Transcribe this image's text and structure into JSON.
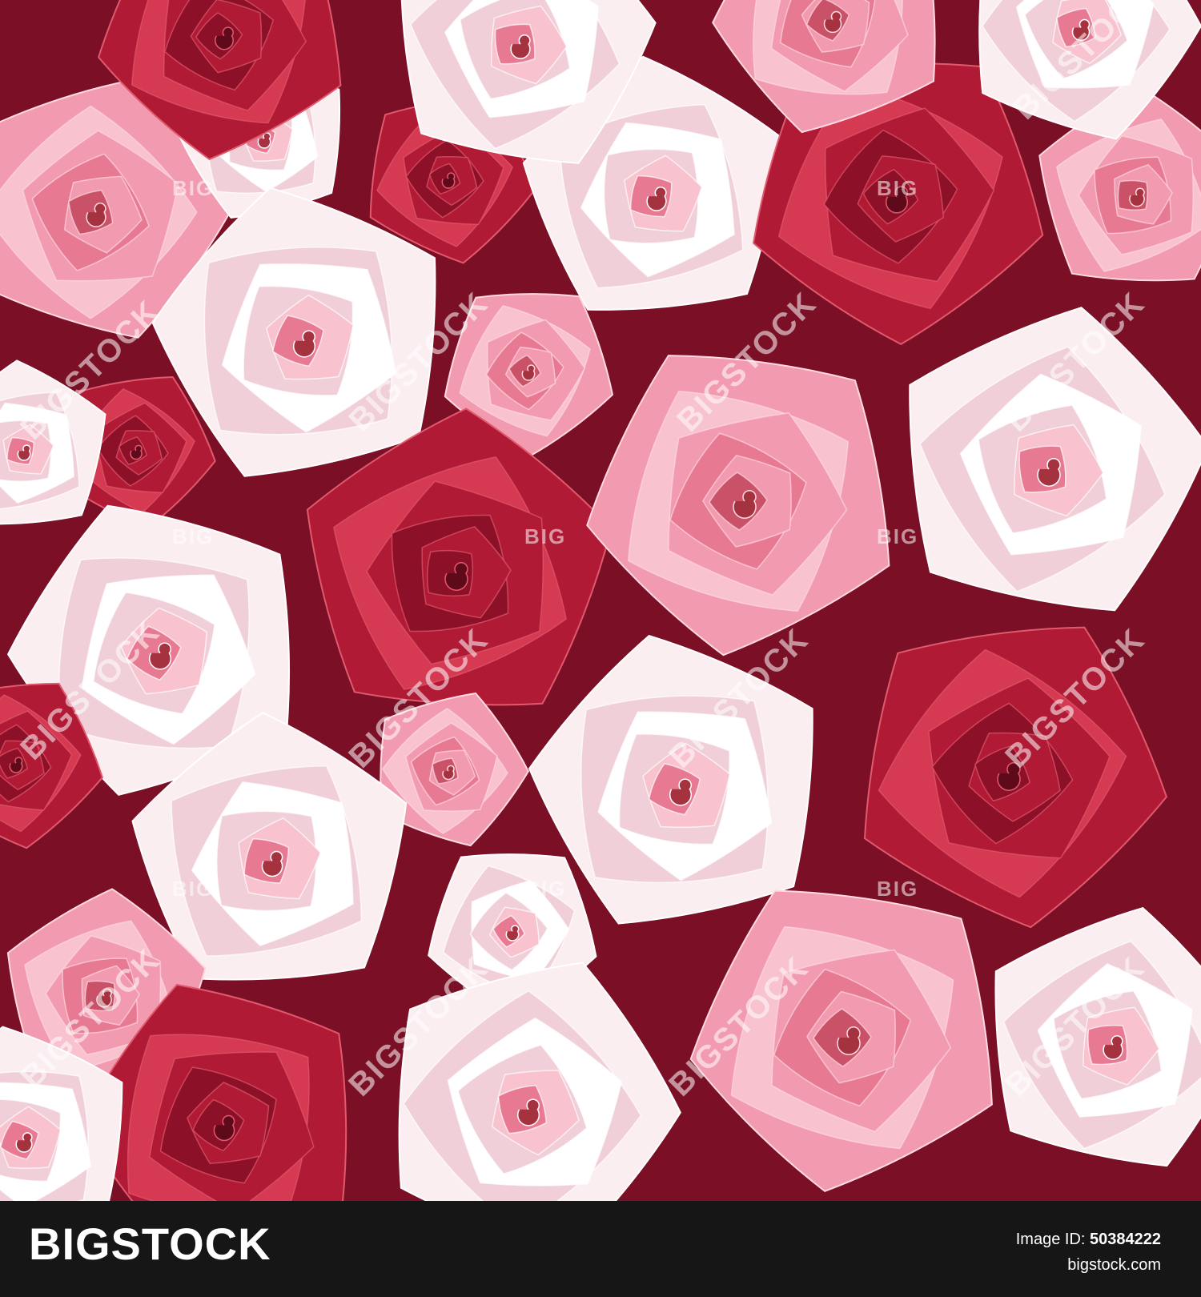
{
  "image": {
    "subject": "seamless-pattern-roses",
    "palette": {
      "background": "#7a0f25",
      "red_dark": "#8c1027",
      "red_mid": "#b01a35",
      "red_light": "#d63a52",
      "pink_dark": "#e77a92",
      "pink_mid": "#f29bb0",
      "pink_light": "#f8c2cf",
      "white": "#fbeef1",
      "white_shadow": "#f0cfd8",
      "center": "#a5333f"
    },
    "rose_colors": [
      "red",
      "pink",
      "white"
    ]
  },
  "watermark": {
    "big_text": "BIGSTOCK",
    "small_text": "BIG"
  },
  "footer": {
    "brand": "BIGSTOCK",
    "image_id_label": "Image ID:",
    "image_id": "50384222",
    "site": "bigstock.com"
  }
}
